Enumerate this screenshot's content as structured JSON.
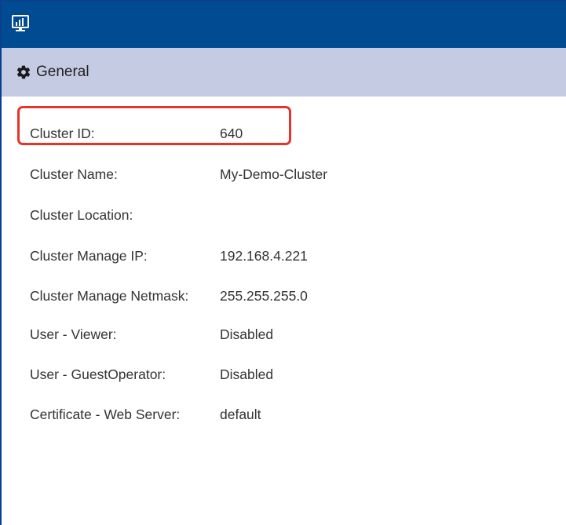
{
  "window": {
    "title_icon": "monitor-chart-icon",
    "titlebar_color": "#004b91"
  },
  "section": {
    "icon": "gear-icon",
    "title": "General",
    "header_color": "#c5cbe3"
  },
  "fields": [
    {
      "label": "Cluster ID:",
      "value": "640",
      "highlighted": true
    },
    {
      "label": "Cluster Name:",
      "value": "My-Demo-Cluster"
    },
    {
      "label": "Cluster Location:",
      "value": ""
    },
    {
      "label": "Cluster Manage IP:",
      "value": "192.168.4.221"
    },
    {
      "label": "Cluster Manage Netmask:",
      "value": "255.255.255.0"
    },
    {
      "label": "User - Viewer:",
      "value": "Disabled"
    },
    {
      "label": "User - GuestOperator:",
      "value": "Disabled"
    },
    {
      "label": "Certificate - Web Server:",
      "value": "default"
    }
  ],
  "highlight_color": "#e8322a"
}
